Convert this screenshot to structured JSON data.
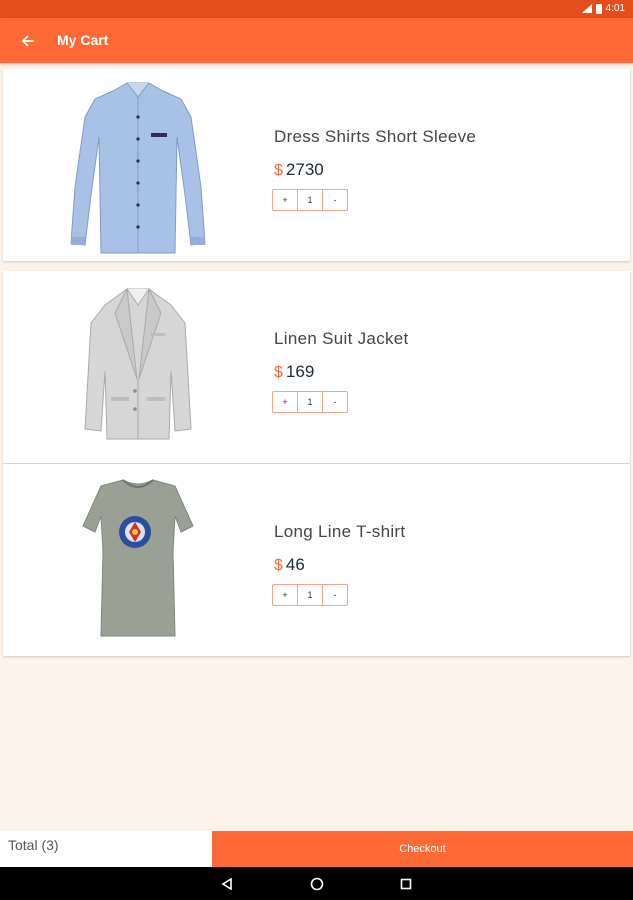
{
  "status_bar": {
    "time": "4:01"
  },
  "app_bar": {
    "title": "My Cart",
    "back_icon": "arrow-back-icon"
  },
  "cart": {
    "items": [
      {
        "name": "Dress Shirts Short Sleeve",
        "currency": "$",
        "price": "2730",
        "qty": "1",
        "plus": "+",
        "minus": "-",
        "image": "blue-dress-shirt-image"
      },
      {
        "name": "Linen Suit Jacket",
        "currency": "$",
        "price": "169",
        "qty": "1",
        "plus": "+",
        "minus": "-",
        "image": "grey-suit-jacket-image"
      },
      {
        "name": "Long Line T-shirt",
        "currency": "$",
        "price": "46",
        "qty": "1",
        "plus": "+",
        "minus": "-",
        "image": "grey-tshirt-image"
      }
    ]
  },
  "footer": {
    "total_label": "Total (3)",
    "checkout_label": "Checkout"
  },
  "colors": {
    "accent": "#fe6a35",
    "status_bar": "#e44d1c",
    "background": "#fdf3ea"
  }
}
